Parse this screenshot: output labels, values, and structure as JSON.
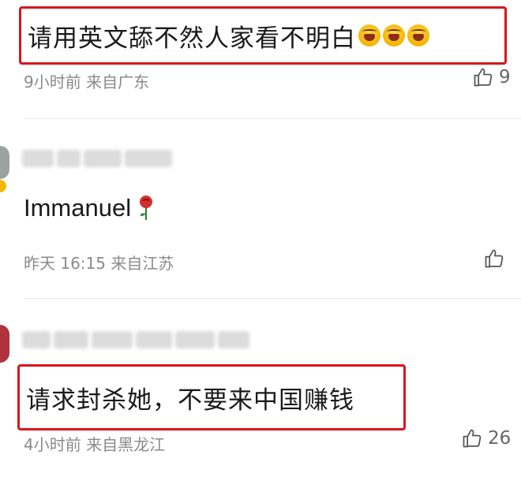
{
  "comments": [
    {
      "text": "请用英文舔不然人家看不明白",
      "emoji_icons": [
        "laughing-crying-emoji",
        "laughing-crying-emoji",
        "laughing-crying-emoji"
      ],
      "time": "9小时前",
      "location": "来自广东",
      "likes": "9"
    },
    {
      "text": "Immanuel",
      "emoji_icon": "rose-emoji",
      "time": "昨天 16:15",
      "location": "来自江苏",
      "likes": ""
    },
    {
      "text": "请求封杀她，不要来中国赚钱",
      "time": "4小时前",
      "location": "来自黑龙江",
      "likes": "26"
    }
  ],
  "colors": {
    "highlight": "#d9151c",
    "meta_text": "#8a8a8a"
  }
}
